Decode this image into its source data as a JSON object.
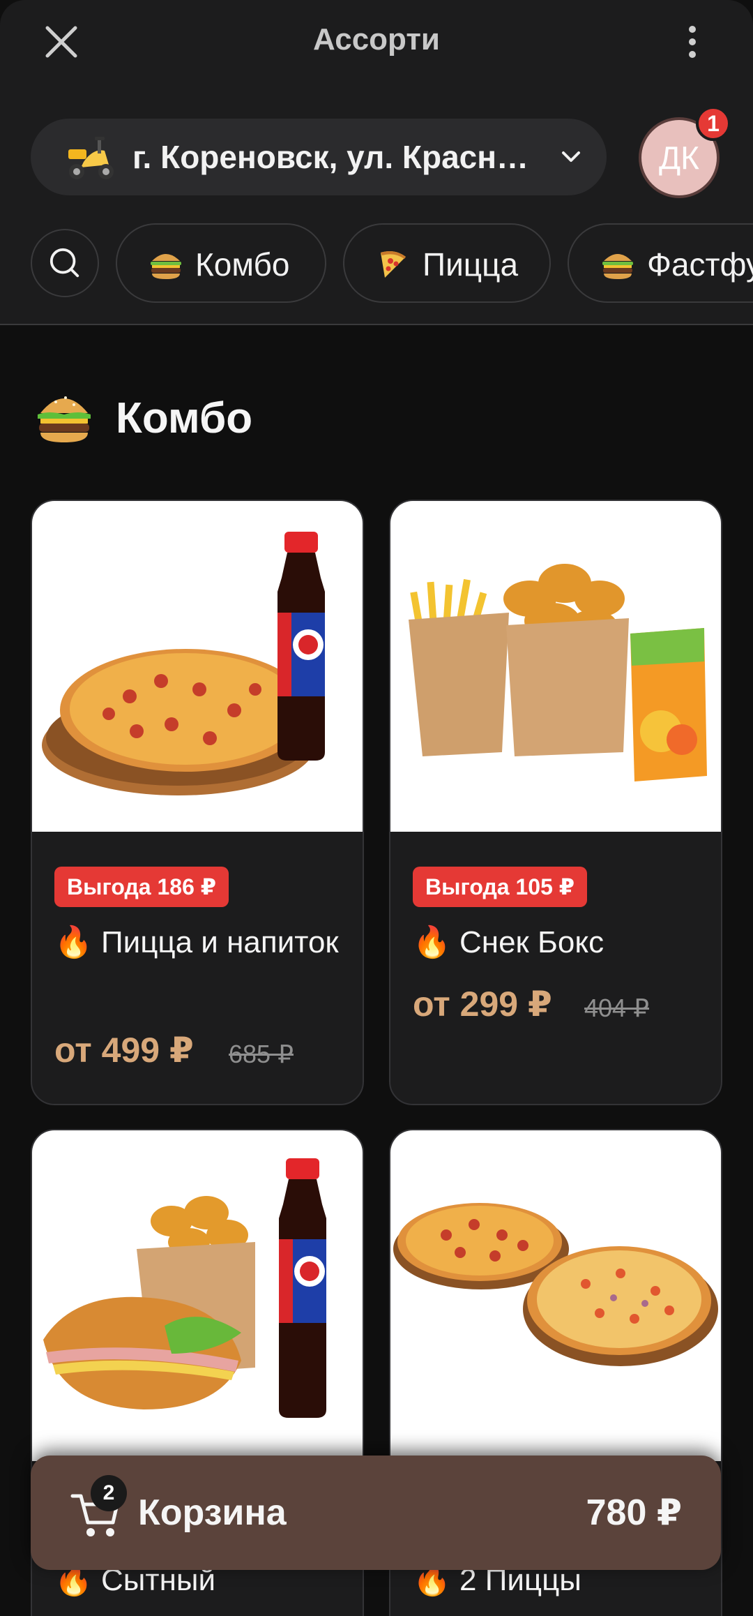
{
  "topbar": {
    "title": "Ассорти",
    "close_icon": "close-icon",
    "menu_icon": "more-vertical-icon"
  },
  "address": {
    "icon": "scooter-icon",
    "text": "г. Кореновск, ул. Красн…"
  },
  "profile": {
    "initials": "ДК",
    "notifications": "1"
  },
  "categories": [
    {
      "icon": "burger-icon",
      "label": "Комбо"
    },
    {
      "icon": "pizza-icon",
      "label": "Пицца"
    },
    {
      "icon": "burger-icon",
      "label": "Фастфуд"
    }
  ],
  "section": {
    "icon": "burger-icon",
    "title": "Комбо"
  },
  "products": [
    {
      "badge": "Выгода 186 ₽",
      "name": "🔥 Пицца и напиток",
      "price": "от 499 ₽",
      "old_price": "685 ₽"
    },
    {
      "badge": "Выгода 105 ₽",
      "name": "🔥 Снек Бокс",
      "price": "от 299 ₽",
      "old_price": "404 ₽"
    },
    {
      "badge": "",
      "name": "🔥 Сытный",
      "price": "",
      "old_price": ""
    },
    {
      "badge": "",
      "name": "🔥 2 Пиццы",
      "price": "",
      "old_price": ""
    }
  ],
  "cart": {
    "icon": "cart-icon",
    "count": "2",
    "label": "Корзина",
    "total": "780 ₽"
  },
  "colors": {
    "accent": "#d8a87a",
    "badge": "#e53935",
    "cart_bg": "#5b433b",
    "background": "#0f0f0f"
  }
}
